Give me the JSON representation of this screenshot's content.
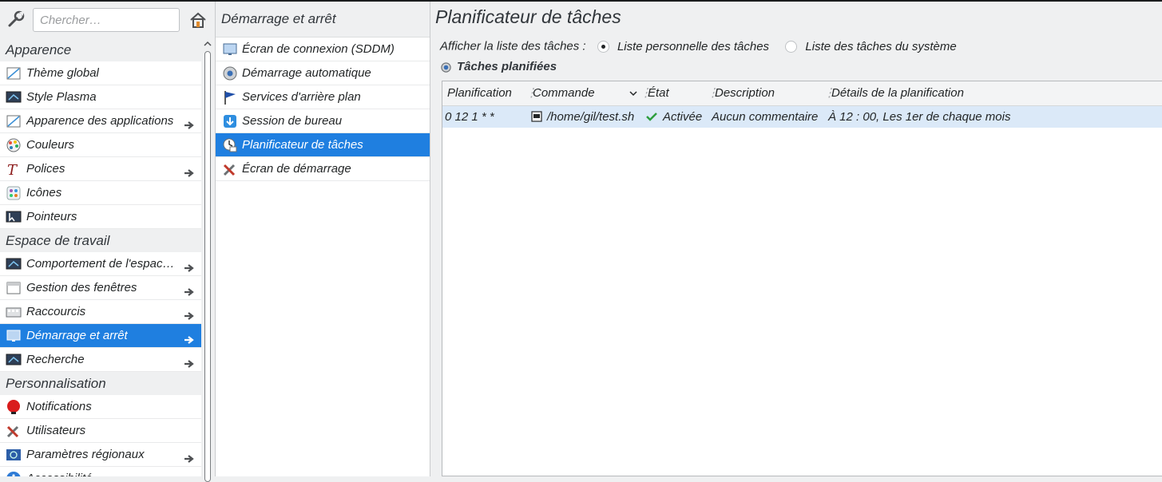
{
  "search": {
    "placeholder": "Chercher…"
  },
  "sidebar": {
    "categories": [
      "Apparence",
      "Espace de travail",
      "Personnalisation"
    ],
    "appearance_items": [
      {
        "label": "Thème global",
        "icon": "theme-icon",
        "arrow": false
      },
      {
        "label": "Style Plasma",
        "icon": "plasma-style-icon",
        "arrow": false
      },
      {
        "label": "Apparence des applications",
        "icon": "app-style-icon",
        "arrow": true
      },
      {
        "label": "Couleurs",
        "icon": "colors-icon",
        "arrow": false
      },
      {
        "label": "Polices",
        "icon": "fonts-icon",
        "arrow": true
      },
      {
        "label": "Icônes",
        "icon": "icons-icon",
        "arrow": false
      },
      {
        "label": "Pointeurs",
        "icon": "cursors-icon",
        "arrow": false
      }
    ],
    "workspace_items": [
      {
        "label": "Comportement de l'espace de travail",
        "icon": "workspace-icon",
        "arrow": true
      },
      {
        "label": "Gestion des fenêtres",
        "icon": "windows-icon",
        "arrow": true
      },
      {
        "label": "Raccourcis",
        "icon": "shortcuts-icon",
        "arrow": true
      },
      {
        "label": "Démarrage et arrêt",
        "icon": "startup-icon",
        "arrow": true,
        "selected": true
      },
      {
        "label": "Recherche",
        "icon": "search-plasma-icon",
        "arrow": true
      }
    ],
    "personal_items": [
      {
        "label": "Notifications",
        "icon": "notifications-icon",
        "arrow": false
      },
      {
        "label": "Utilisateurs",
        "icon": "users-icon",
        "arrow": false
      },
      {
        "label": "Paramètres régionaux",
        "icon": "regional-icon",
        "arrow": true
      },
      {
        "label": "Accessibilité",
        "icon": "accessibility-icon",
        "arrow": false
      }
    ]
  },
  "middle": {
    "title": "Démarrage et arrêt",
    "items": [
      {
        "label": "Écran de connexion (SDDM)",
        "icon": "login-screen-icon"
      },
      {
        "label": "Démarrage automatique",
        "icon": "autostart-icon"
      },
      {
        "label": "Services d'arrière plan",
        "icon": "services-icon"
      },
      {
        "label": "Session de bureau",
        "icon": "session-icon"
      },
      {
        "label": "Planificateur de tâches",
        "icon": "task-scheduler-icon",
        "selected": true
      },
      {
        "label": "Écran de démarrage",
        "icon": "splash-icon"
      }
    ]
  },
  "main": {
    "title": "Planificateur de tâches",
    "show_label": "Afficher la liste des tâches :",
    "radio_personal": "Liste personnelle des tâches",
    "radio_system": "Liste des tâches du système",
    "radio_selected": "personal",
    "group_title": "Tâches planifiées",
    "columns": [
      "Planification",
      "Commande",
      "État",
      "Description",
      "Détails de la planification"
    ],
    "rows": [
      {
        "schedule": "0 12 1 * *",
        "command": "/home/gil/test.sh",
        "state": "Activée",
        "description": "Aucun commentaire",
        "details": "À 12 : 00, Les 1er de chaque mois"
      }
    ]
  },
  "colors": {
    "selection": "#1f7fe0",
    "row_highlight": "#dbe9f8",
    "check": "#2e9e3e"
  }
}
